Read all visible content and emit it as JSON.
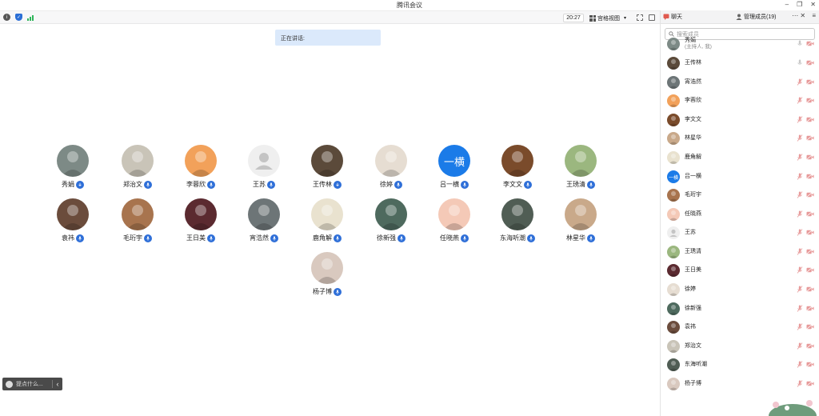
{
  "app": {
    "title": "腾讯会议"
  },
  "toolbar": {
    "time": "20:27",
    "view_label": "宫格视图"
  },
  "speaking_label": "正在讲话:",
  "tiles": [
    {
      "name": "秀娟",
      "bg": "#7d8a86",
      "badge": "download"
    },
    {
      "name": "郑治文",
      "bg": "#c9c4b8",
      "badge": "mic"
    },
    {
      "name": "李蓉欣",
      "bg": "#f2a15a",
      "badge": "mic"
    },
    {
      "name": "王苏",
      "bg": "#efefef",
      "badge": "mic"
    },
    {
      "name": "王传林",
      "bg": "#5b4a3a",
      "badge": "download"
    },
    {
      "name": "徐婷",
      "bg": "#e6ddd2",
      "badge": "mic"
    },
    {
      "name": "吕一横",
      "bg": "#1b7be8",
      "badge": "mic",
      "initials": "一横"
    },
    {
      "name": "李文文",
      "bg": "#7a4b2b",
      "badge": "mic"
    },
    {
      "name": "王琇清",
      "bg": "#9bb77f",
      "badge": "mic"
    },
    {
      "name": "袁祎",
      "bg": "#6b4c3c",
      "badge": "mic"
    },
    {
      "name": "毛珩宇",
      "bg": "#a8744e",
      "badge": "mic"
    },
    {
      "name": "王日美",
      "bg": "#5b2a30",
      "badge": "mic"
    },
    {
      "name": "宵浩然",
      "bg": "#6d7577",
      "badge": "mic"
    },
    {
      "name": "鹿角解",
      "bg": "#e9e2cf",
      "badge": "mic"
    },
    {
      "name": "徐新强",
      "bg": "#4e6a5e",
      "badge": "mic"
    },
    {
      "name": "任晓燕",
      "bg": "#f4c9b7",
      "badge": "mic"
    },
    {
      "name": "东海听潮",
      "bg": "#505d54",
      "badge": "mic"
    },
    {
      "name": "林星华",
      "bg": "#c9a98a",
      "badge": "mic"
    },
    {
      "name": "杨子博",
      "bg": "#d9c9bf",
      "badge": "mic"
    }
  ],
  "feedback": {
    "placeholder": "提点什么..."
  },
  "sidebar": {
    "tabs": [
      {
        "label": "聊天"
      },
      {
        "label": "管理成员(19)"
      }
    ],
    "search_placeholder": "搜索成员",
    "members": [
      {
        "name": "秀娟",
        "sub": "(主持人, 我)",
        "bg": "#7d8a86",
        "mic": "on",
        "cam": "off"
      },
      {
        "name": "王传林",
        "bg": "#5b4a3a",
        "mic": "on",
        "cam": "off"
      },
      {
        "name": "宵浩然",
        "bg": "#6d7577",
        "mic": "off",
        "cam": "off"
      },
      {
        "name": "李蓉欣",
        "bg": "#f2a15a",
        "mic": "off",
        "cam": "off"
      },
      {
        "name": "李文文",
        "bg": "#7a4b2b",
        "mic": "off",
        "cam": "off"
      },
      {
        "name": "林星华",
        "bg": "#c9a98a",
        "mic": "off",
        "cam": "off"
      },
      {
        "name": "鹿角解",
        "bg": "#e9e2cf",
        "mic": "off",
        "cam": "off"
      },
      {
        "name": "吕一横",
        "bg": "#1b7be8",
        "mic": "off",
        "cam": "off",
        "initials": "一横"
      },
      {
        "name": "毛珩宇",
        "bg": "#a8744e",
        "mic": "off",
        "cam": "off"
      },
      {
        "name": "任晓燕",
        "bg": "#f4c9b7",
        "mic": "off",
        "cam": "off"
      },
      {
        "name": "王苏",
        "bg": "#efefef",
        "mic": "off",
        "cam": "off"
      },
      {
        "name": "王琇清",
        "bg": "#9bb77f",
        "mic": "off",
        "cam": "off"
      },
      {
        "name": "王日美",
        "bg": "#5b2a30",
        "mic": "off",
        "cam": "off"
      },
      {
        "name": "徐婷",
        "bg": "#e6ddd2",
        "mic": "off",
        "cam": "off"
      },
      {
        "name": "徐新强",
        "bg": "#4e6a5e",
        "mic": "off",
        "cam": "off"
      },
      {
        "name": "袁祎",
        "bg": "#6b4c3c",
        "mic": "off",
        "cam": "off"
      },
      {
        "name": "郑治文",
        "bg": "#c9c4b8",
        "mic": "off",
        "cam": "off"
      },
      {
        "name": "东海听潮",
        "bg": "#505d54",
        "mic": "off",
        "cam": "off"
      },
      {
        "name": "杨子博",
        "bg": "#d9c9bf",
        "mic": "off",
        "cam": "off"
      }
    ]
  },
  "colors": {
    "accent": "#2f6fd8",
    "muted_red": "#e07b7b",
    "signal_green": "#2fb55a"
  },
  "icons": {
    "info": "info-icon",
    "shield": "shield-icon",
    "signal": "signal-icon",
    "search": "search-icon",
    "mic": "mic-icon",
    "camera": "camera-icon"
  }
}
